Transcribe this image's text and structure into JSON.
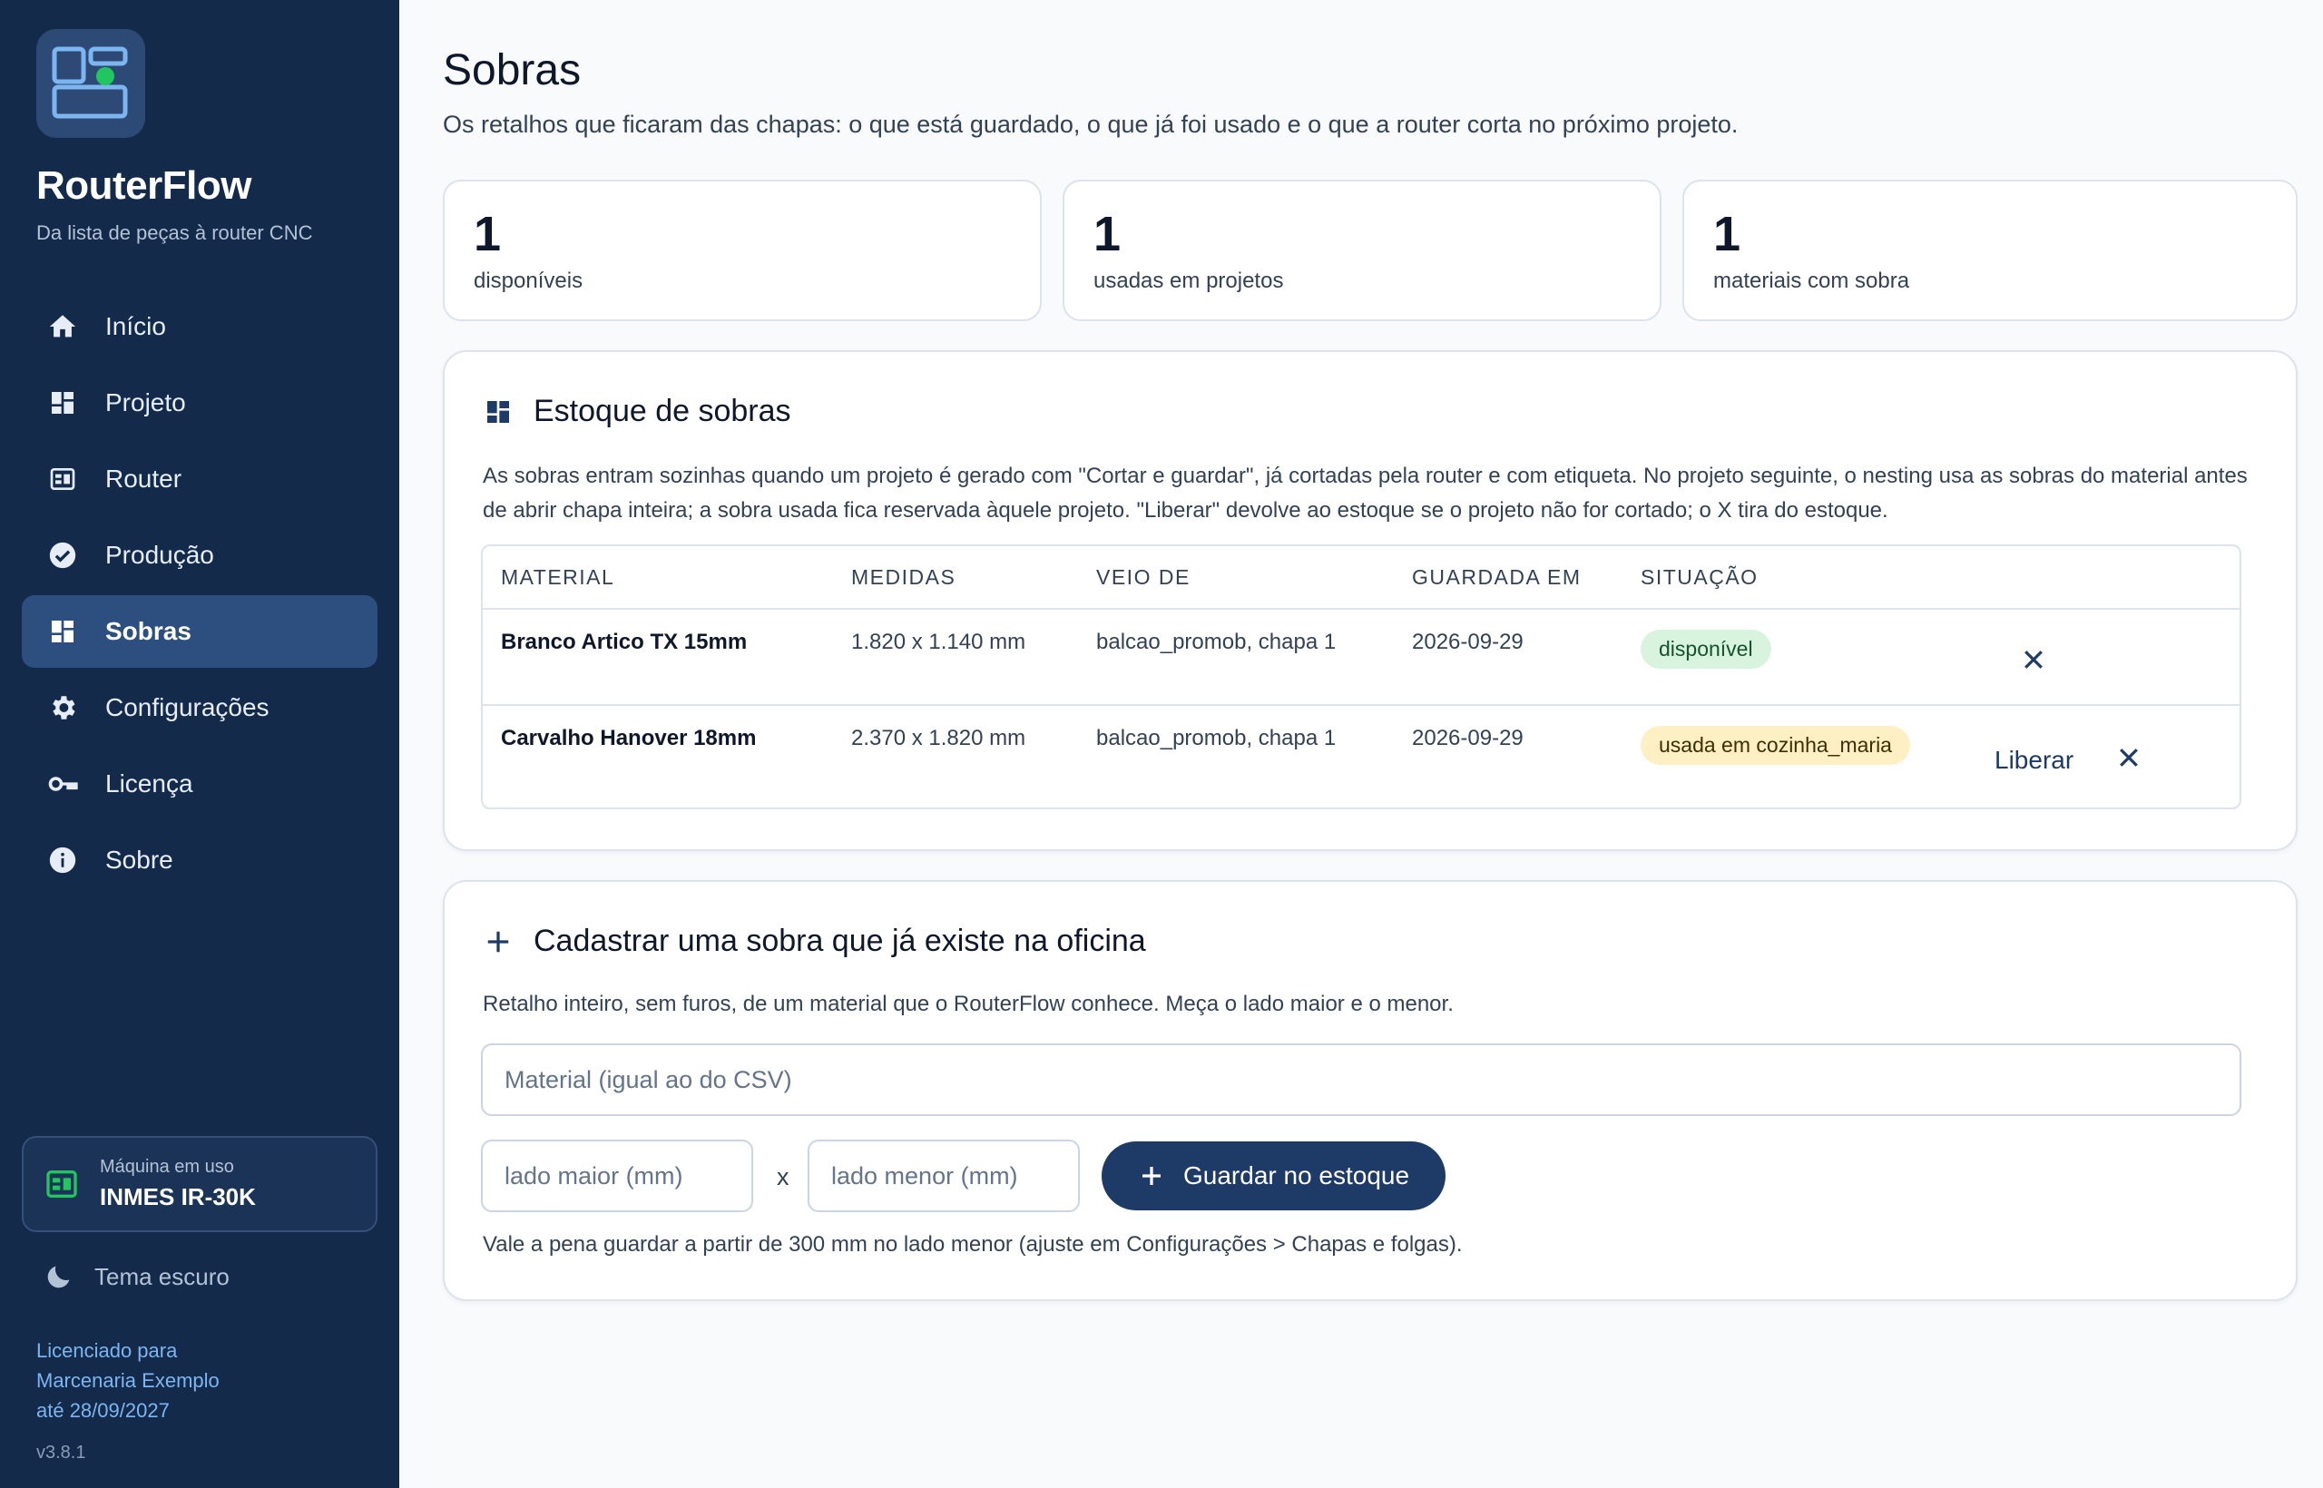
{
  "app": {
    "name": "RouterFlow",
    "tagline": "Da lista de peças à router CNC"
  },
  "nav": {
    "items": [
      {
        "label": "Início",
        "icon": "home-icon"
      },
      {
        "label": "Projeto",
        "icon": "dashboard-icon"
      },
      {
        "label": "Router",
        "icon": "router-icon"
      },
      {
        "label": "Produção",
        "icon": "check-circle-icon"
      },
      {
        "label": "Sobras",
        "icon": "dashboard-icon",
        "active": true
      },
      {
        "label": "Configurações",
        "icon": "gear-icon"
      },
      {
        "label": "Licença",
        "icon": "key-icon"
      },
      {
        "label": "Sobre",
        "icon": "info-icon"
      }
    ]
  },
  "machine": {
    "label": "Máquina em uso",
    "value": "INMES IR-30K"
  },
  "theme": {
    "label": "Tema escuro"
  },
  "license": {
    "line1": "Licenciado para",
    "line2": "Marcenaria Exemplo",
    "line3": "até 28/09/2027"
  },
  "version": "v3.8.1",
  "page": {
    "title": "Sobras",
    "subtitle": "Os retalhos que ficaram das chapas: o que está guardado, o que já foi usado e o que a router corta no próximo projeto."
  },
  "stats": [
    {
      "value": "1",
      "label": "disponíveis"
    },
    {
      "value": "1",
      "label": "usadas em projetos"
    },
    {
      "value": "1",
      "label": "materiais com sobra"
    }
  ],
  "stock": {
    "title": "Estoque de sobras",
    "description": "As sobras entram sozinhas quando um projeto é gerado com \"Cortar e guardar\", já cortadas pela router e com etiqueta. No projeto seguinte, o nesting usa as sobras do material antes de abrir chapa inteira; a sobra usada fica reservada àquele projeto. \"Liberar\" devolve ao estoque se o projeto não for cortado; o X tira do estoque.",
    "columns": [
      "MATERIAL",
      "MEDIDAS",
      "VEIO DE",
      "GUARDADA EM",
      "SITUAÇÃO"
    ],
    "rows": [
      {
        "material": "Branco Artico TX 15mm",
        "dims": "1.820 x 1.140 mm",
        "origin": "balcao_promob, chapa 1",
        "date": "2026-09-29",
        "status": "disponível",
        "status_color": "#d8f3de"
      },
      {
        "material": "Carvalho Hanover 18mm",
        "dims": "2.370 x 1.820 mm",
        "origin": "balcao_promob, chapa 1",
        "date": "2026-09-29",
        "status": "usada em cozinha_maria",
        "status_color": "#fdf0c4",
        "action": "Liberar"
      }
    ]
  },
  "register": {
    "title": "Cadastrar uma sobra que já existe na oficina",
    "description": "Retalho inteiro, sem furos, de um material que o RouterFlow conhece. Meça o lado maior e o menor.",
    "material_placeholder": "Material (igual ao do CSV)",
    "major_placeholder": "lado maior (mm)",
    "times": "x",
    "minor_placeholder": "lado menor (mm)",
    "button": "Guardar no estoque",
    "hint": "Vale a pena guardar a partir de 300 mm no lado menor (ajuste em Configurações > Chapas e folgas)."
  },
  "colors": {
    "sidebar": "#132a4b",
    "active_nav": "#2d4f80",
    "primary": "#1e3a66",
    "accent_green": "#22c55e"
  }
}
